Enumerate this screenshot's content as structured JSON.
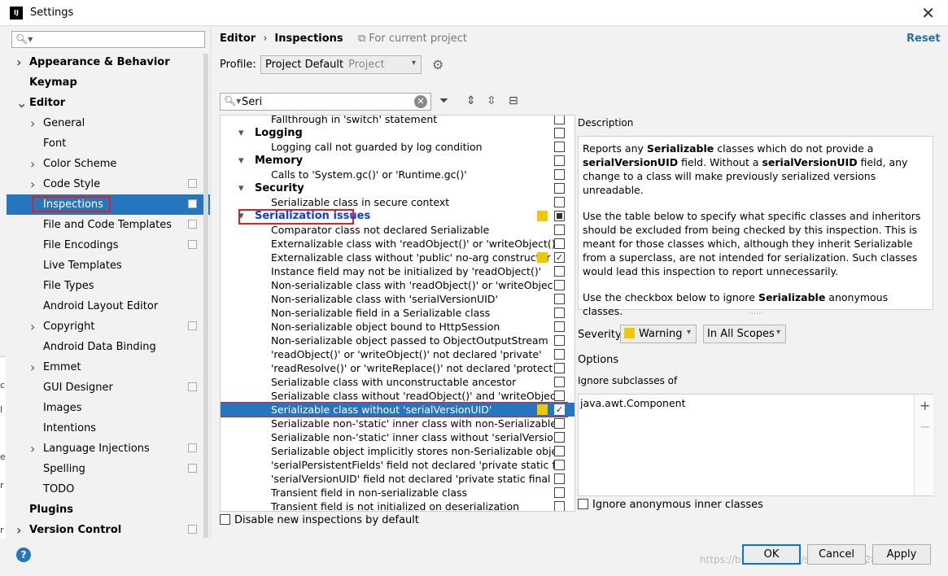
{
  "window": {
    "title": "Settings",
    "app_icon": "IJ"
  },
  "left_panel": {
    "search_placeholder": "",
    "items": [
      {
        "label": "Appearance & Behavior",
        "bold": true,
        "level": 0,
        "arrow": "right"
      },
      {
        "label": "Keymap",
        "bold": true,
        "level": 0,
        "arrow": ""
      },
      {
        "label": "Editor",
        "bold": true,
        "level": 0,
        "arrow": "down"
      },
      {
        "label": "General",
        "level": 1,
        "arrow": "right"
      },
      {
        "label": "Font",
        "level": 1,
        "arrow": ""
      },
      {
        "label": "Color Scheme",
        "level": 1,
        "arrow": "right"
      },
      {
        "label": "Code Style",
        "level": 1,
        "arrow": "right",
        "project": true
      },
      {
        "label": "Inspections",
        "level": 1,
        "arrow": "",
        "project": true,
        "selected": true
      },
      {
        "label": "File and Code Templates",
        "level": 1,
        "arrow": "",
        "project": true
      },
      {
        "label": "File Encodings",
        "level": 1,
        "arrow": "",
        "project": true
      },
      {
        "label": "Live Templates",
        "level": 1,
        "arrow": ""
      },
      {
        "label": "File Types",
        "level": 1,
        "arrow": ""
      },
      {
        "label": "Android Layout Editor",
        "level": 1,
        "arrow": ""
      },
      {
        "label": "Copyright",
        "level": 1,
        "arrow": "right",
        "project": true
      },
      {
        "label": "Android Data Binding",
        "level": 1,
        "arrow": ""
      },
      {
        "label": "Emmet",
        "level": 1,
        "arrow": "right"
      },
      {
        "label": "GUI Designer",
        "level": 1,
        "arrow": "",
        "project": true
      },
      {
        "label": "Images",
        "level": 1,
        "arrow": ""
      },
      {
        "label": "Intentions",
        "level": 1,
        "arrow": ""
      },
      {
        "label": "Language Injections",
        "level": 1,
        "arrow": "right",
        "project": true
      },
      {
        "label": "Spelling",
        "level": 1,
        "arrow": "",
        "project": true
      },
      {
        "label": "TODO",
        "level": 1,
        "arrow": ""
      },
      {
        "label": "Plugins",
        "bold": true,
        "level": 0,
        "arrow": ""
      },
      {
        "label": "Version Control",
        "bold": true,
        "level": 0,
        "arrow": "right",
        "project": true
      }
    ]
  },
  "header": {
    "crumb1": "Editor",
    "crumb_sep": "›",
    "crumb2": "Inspections",
    "for_project": "For current project",
    "reset": "Reset"
  },
  "profile": {
    "label": "Profile:",
    "name": "Project Default",
    "sub": "Project"
  },
  "filter": {
    "value": "Seri"
  },
  "tree": [
    {
      "label": "Fallthrough in 'switch' statement",
      "level": 2,
      "cb": "off"
    },
    {
      "label": "Logging",
      "level": 1,
      "group": true,
      "cb": "off"
    },
    {
      "label": "Logging call not guarded by log condition",
      "level": 2,
      "cb": "off"
    },
    {
      "label": "Memory",
      "level": 1,
      "group": true,
      "cb": "off"
    },
    {
      "label": "Calls to 'System.gc()' or 'Runtime.gc()'",
      "level": 2,
      "cb": "off"
    },
    {
      "label": "Security",
      "level": 1,
      "group": true,
      "cb": "off"
    },
    {
      "label": "Serializable class in secure context",
      "level": 2,
      "cb": "off"
    },
    {
      "label": "Serialization issues",
      "level": 1,
      "group": true,
      "link": true,
      "cb": "mixed",
      "sev": true
    },
    {
      "label": "Comparator class not declared Serializable",
      "level": 2,
      "cb": "off"
    },
    {
      "label": "Externalizable class with 'readObject()' or 'writeObject()'",
      "level": 2,
      "cb": "off"
    },
    {
      "label": "Externalizable class without 'public' no-arg constructor",
      "level": 2,
      "cb": "on",
      "sev": true
    },
    {
      "label": "Instance field may not be initialized by 'readObject()'",
      "level": 2,
      "cb": "off"
    },
    {
      "label": "Non-serializable class with 'readObject()' or 'writeObjec",
      "level": 2,
      "cb": "off"
    },
    {
      "label": "Non-serializable class with 'serialVersionUID'",
      "level": 2,
      "cb": "off"
    },
    {
      "label": "Non-serializable field in a Serializable class",
      "level": 2,
      "cb": "off"
    },
    {
      "label": "Non-serializable object bound to HttpSession",
      "level": 2,
      "cb": "off"
    },
    {
      "label": "Non-serializable object passed to ObjectOutputStream",
      "level": 2,
      "cb": "off"
    },
    {
      "label": "'readObject()' or 'writeObject()' not declared 'private'",
      "level": 2,
      "cb": "off"
    },
    {
      "label": "'readResolve()' or 'writeReplace()' not declared 'protect",
      "level": 2,
      "cb": "off"
    },
    {
      "label": "Serializable class with unconstructable ancestor",
      "level": 2,
      "cb": "off"
    },
    {
      "label": "Serializable class without 'readObject()' and 'writeObjec",
      "level": 2,
      "cb": "off"
    },
    {
      "label": "Serializable class without 'serialVersionUID'",
      "level": 2,
      "cb": "on",
      "sev": true,
      "selected": true
    },
    {
      "label": "Serializable non-'static' inner class with non-Serializable",
      "level": 2,
      "cb": "off"
    },
    {
      "label": "Serializable non-'static' inner class without 'serialVersion",
      "level": 2,
      "cb": "off"
    },
    {
      "label": "Serializable object implicitly stores non-Serializable obje",
      "level": 2,
      "cb": "off"
    },
    {
      "label": "'serialPersistentFields' field not declared 'private static f",
      "level": 2,
      "cb": "off"
    },
    {
      "label": "'serialVersionUID' field not declared 'private static final",
      "level": 2,
      "cb": "off"
    },
    {
      "label": "Transient field in non-serializable class",
      "level": 2,
      "cb": "off"
    },
    {
      "label": "Transient field is not initialized on deserialization",
      "level": 2,
      "cb": "off"
    }
  ],
  "disable_new": "Disable new inspections by default",
  "description": {
    "label": "Description",
    "p1_a": "Reports any ",
    "p1_b": "Serializable",
    "p1_c": " classes which do not provide a ",
    "p1_d": "serialVersionUID",
    "p1_e": " field. Without a ",
    "p1_f": "serialVersionUID",
    "p1_g": " field, any change to a class will make previously serialized versions unreadable.",
    "p2": "Use the table below to specify what specific classes and inheritors should be excluded from being checked by this inspection. This is meant for those classes which, although they inherit Serializable from a superclass, are not intended for serialization. Such classes would lead this inspection to report unnecessarily.",
    "p3_a": "Use the checkbox below to ignore ",
    "p3_b": "Serializable",
    "p3_c": " anonymous classes."
  },
  "severity": {
    "label": "Severity:",
    "value": "Warning",
    "scope": "In All Scopes",
    "color": "#f0c800"
  },
  "options": {
    "label": "Options",
    "ignore_subclasses_label": "Ignore subclasses of",
    "subclasses": [
      "java.awt.Component"
    ],
    "ignore_anonymous": "Ignore anonymous inner classes"
  },
  "buttons": {
    "ok": "OK",
    "cancel": "Cancel",
    "apply": "Apply",
    "help": "?"
  },
  "watermark": "https://blog.csdn.net/shaohe1836282128",
  "colors": {
    "selection": "#2675bf",
    "highlight_box": "#e02020",
    "link": "#0b3fe0",
    "accent": "#2470b3"
  }
}
